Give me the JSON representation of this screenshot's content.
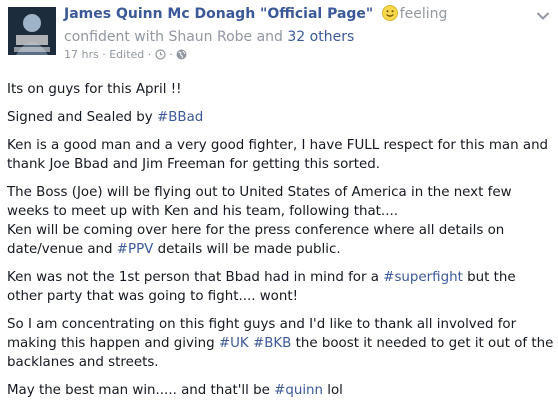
{
  "header": {
    "page_name": "James Quinn Mc Donagh \"Official Page\"",
    "feeling": "feeling",
    "feeling_word": "confident",
    "with_text": "with",
    "tagged_person": "Shaun Robe",
    "and_text": "and",
    "others_link": "32 others",
    "time": "17 hrs",
    "edited": "Edited",
    "sep": "·",
    "icons": [
      "smiley-icon",
      "clock-icon",
      "globe-icon",
      "chevron-down-icon"
    ]
  },
  "post": {
    "p1": "Its on guys for this April !!",
    "p2_text": "Signed and Sealed by ",
    "p2_tag": "#BBad",
    "p3": "Ken is a good man and a very good fighter, I have FULL respect for this man and thank Joe Bbad and Jim Freeman for getting this sorted.",
    "p4_line1": "The Boss (Joe) will be flying out to United States of America in the next few weeks to meet up with Ken and his team, following that....",
    "p4_line2a": "Ken will be coming over here for the press conference where all details on date/venue and ",
    "p4_tag": "#PPV",
    "p4_line2b": " details will be made public.",
    "p5a": "Ken was not the 1st person that Bbad had in mind for a ",
    "p5_tag": "#superfight",
    "p5b": " but the other party that was going to fight.... wont!",
    "p6a": "So I am concentrating on this fight guys and I'd like to thank all involved for making this happen and giving ",
    "p6_tag1": "#UK",
    "p6_space": " ",
    "p6_tag2": "#BKB",
    "p6b": " the boost it needed to get it out of the backlanes and streets.",
    "p7a": "May the best man win..... and that'll be ",
    "p7_tag": "#quinn",
    "p7b": " lol"
  },
  "colors": {
    "link": "#3b5998",
    "meta": "#9197a3",
    "text": "#141823"
  }
}
